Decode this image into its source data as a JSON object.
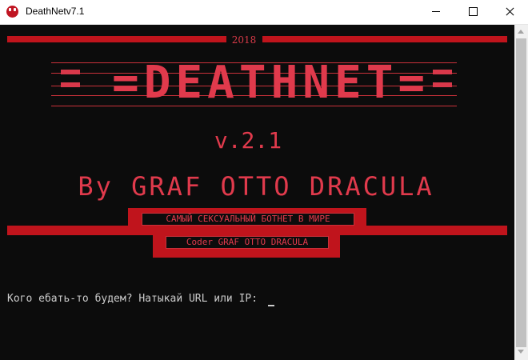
{
  "window": {
    "title": "DeathNetv7.1",
    "icon": "skull-icon"
  },
  "banner": {
    "year": "2018",
    "logo": "=DEATHNET=",
    "version": "v.2.1",
    "byline": "By GRAF OTTO DRACULA",
    "slogan": "САМЫЙ СЕКСУАЛЬНЫЙ БОТНЕТ В МИРЕ",
    "coder": "Coder GRAF OTTO DRACULA"
  },
  "console": {
    "prompt": "Кого ебать-то будем? Натыкай URL или IP:"
  },
  "colors": {
    "background": "#0c0c0c",
    "accent": "#c0141c",
    "text": "#cccccc"
  }
}
